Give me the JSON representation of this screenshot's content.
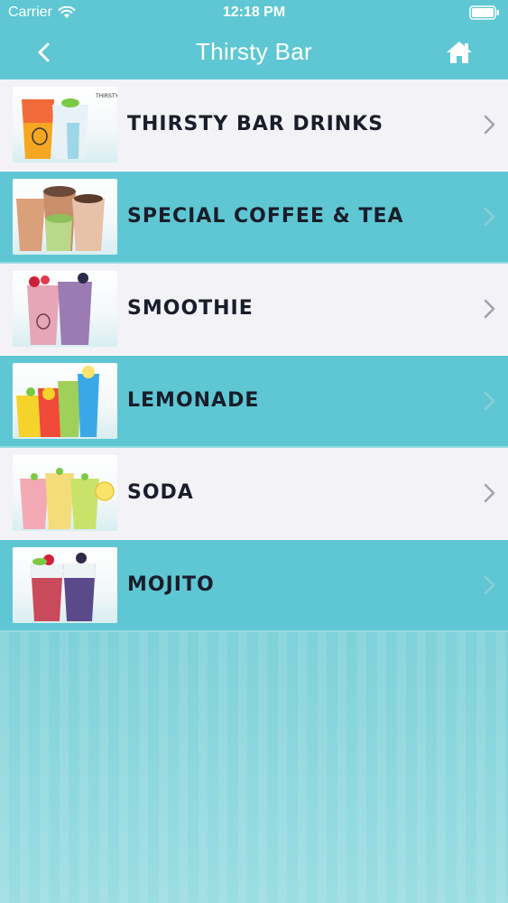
{
  "status_bar": {
    "carrier": "Carrier",
    "time": "12:18 PM"
  },
  "nav": {
    "title": "Thirsty Bar",
    "back_icon": "chevron-left-icon",
    "home_icon": "home-icon"
  },
  "colors": {
    "accent": "#5ec7d3",
    "row_light": "#f2f2f7",
    "label_text": "#1a1d2a"
  },
  "menu": {
    "items": [
      {
        "label": "THIRSTY BAR DRINKS"
      },
      {
        "label": "SPECIAL COFFEE & TEA"
      },
      {
        "label": "SMOOTHIE"
      },
      {
        "label": "LEMONADE"
      },
      {
        "label": "SODA"
      },
      {
        "label": "MOJITO"
      }
    ]
  }
}
